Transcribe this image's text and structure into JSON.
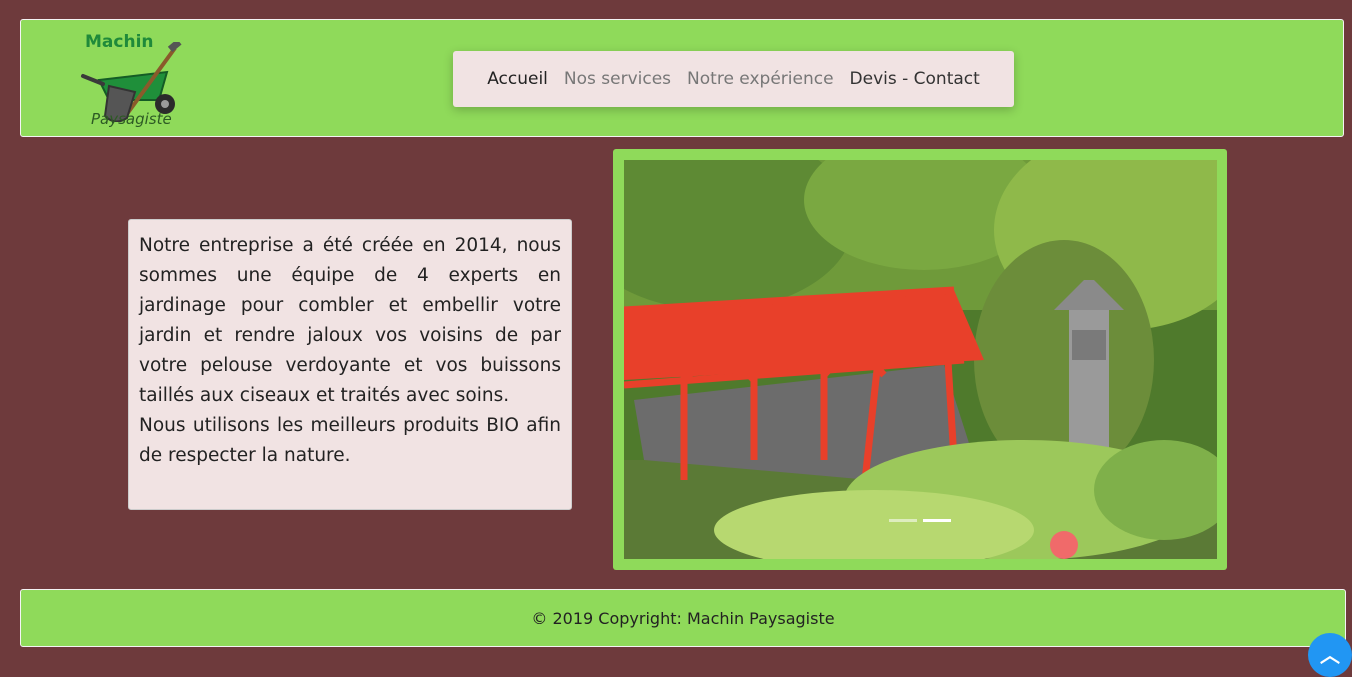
{
  "logo": {
    "top": "Machin",
    "bottom": "Paysagiste",
    "icon": "wheelbarrow-shovel-icon"
  },
  "nav": {
    "items": [
      {
        "label": "Accueil"
      },
      {
        "label": "Nos services"
      },
      {
        "label": "Notre expérience"
      },
      {
        "label": "Devis - Contact"
      }
    ]
  },
  "main": {
    "paragraph1": "Notre entreprise a été créée en 2014, nous sommes une équipe de 4 experts en jardinage pour combler et embellir votre jardin et rendre jaloux vos voisins de par votre pelouse verdoyante et vos buissons taillés aux ciseaux et traités avec soins.",
    "paragraph2": "Nous utilisons les meilleurs produits BIO afin de respecter la nature."
  },
  "carousel": {
    "slides": 2,
    "active_slide": 2
  },
  "footer": {
    "text": "© 2019 Copyright: Machin Paysagiste"
  },
  "scroll_top": {
    "icon": "chevron-up-icon"
  },
  "colors": {
    "background": "#6e3a3c",
    "accent_green": "#8fda5a",
    "panel": "#f1e3e3",
    "scroll_button": "#2196f3"
  }
}
